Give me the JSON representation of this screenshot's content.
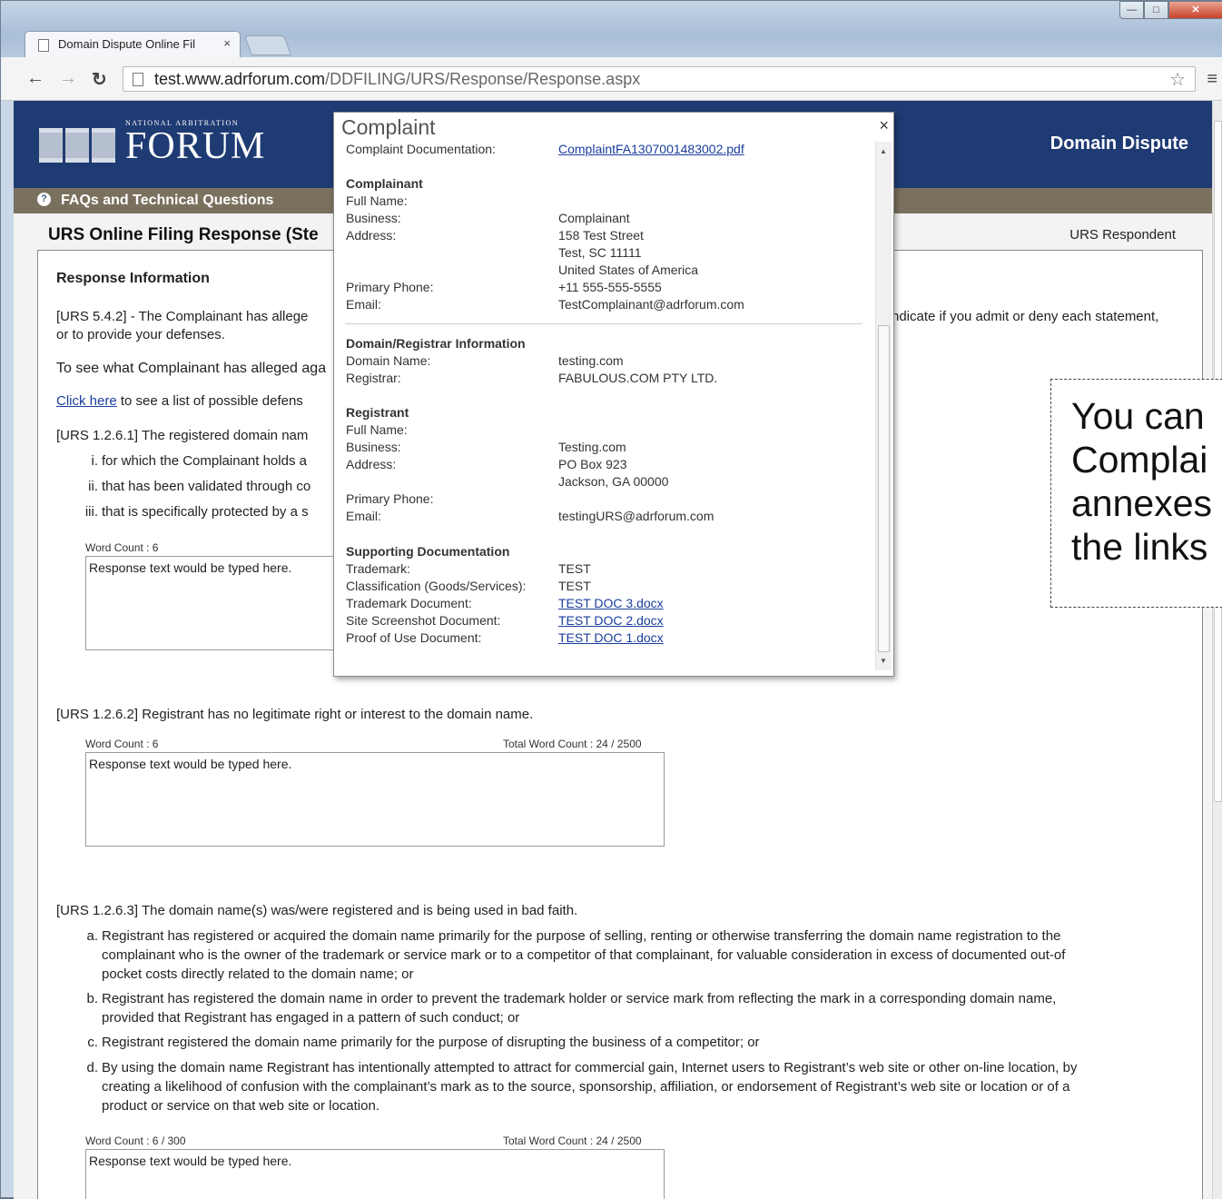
{
  "browser": {
    "tab_title": "Domain Dispute Online Fil",
    "tab_close": "×",
    "url_host": "test.www.adrforum.com",
    "url_path": "/DDFILING/URS/Response/Response.aspx",
    "window_controls": {
      "minimize": "—",
      "maximize": "□",
      "close": "✕"
    }
  },
  "header": {
    "logo_small": "NATIONAL ARBITRATION",
    "logo_big": "FORUM",
    "title": "Domain Dispute",
    "faq_icon": "?",
    "faq_label": "FAQs and Technical Questions"
  },
  "page": {
    "title": "URS Online Filing Response (Ste",
    "role": "URS Respondent"
  },
  "content": {
    "section_heading": "Response Information",
    "intro_1a": "[URS 5.4.2] - The Complainant has allege",
    "intro_1b": "ndicate if you admit or deny each statement,",
    "intro_2": "or to provide your defenses.",
    "see_alleged": "To see what Complainant has alleged aga",
    "click_here": "Click here",
    "click_rest": " to see a list of possible defens",
    "q1": {
      "prompt": "[URS 1.2.6.1] The registered domain nam",
      "items": [
        {
          "marker": "i.",
          "text": "for which the Complainant holds a"
        },
        {
          "marker": "ii.",
          "text": "that has been validated through co"
        },
        {
          "marker": "iii.",
          "text": "that is specifically protected by a s"
        }
      ],
      "word_count": "Word Count : 6",
      "response": "Response text would be typed here."
    },
    "q2": {
      "prompt": "[URS 1.2.6.2] Registrant has no legitimate right or interest to the domain name.",
      "word_count": "Word Count : 6",
      "total_word_count": "Total Word Count : 24 / 2500",
      "response": "Response text would be typed here."
    },
    "q3": {
      "prompt": "[URS 1.2.6.3] The domain name(s) was/were registered and is being used in bad faith.",
      "items": [
        {
          "marker": "a.",
          "lines": [
            "Registrant has registered or acquired the domain name primarily for the purpose of selling, renting or otherwise transferring the domain name registration to the",
            "complainant who is the owner of the trademark or service mark or to a competitor of that complainant, for valuable consideration in excess of documented out-of",
            "pocket costs directly related to the domain name; or"
          ]
        },
        {
          "marker": "b.",
          "lines": [
            "Registrant has registered the domain name in order to prevent the trademark holder or service mark from reflecting the mark in a corresponding domain name,",
            "provided that Registrant has engaged in a pattern of such conduct; or"
          ]
        },
        {
          "marker": "c.",
          "lines": [
            "Registrant registered the domain name primarily for the purpose of disrupting the business of a competitor; or"
          ]
        },
        {
          "marker": "d.",
          "lines": [
            "By using the domain name Registrant has intentionally attempted to attract for commercial gain, Internet users to Registrant’s web site or other on-line location, by",
            "creating a likelihood of confusion with the complainant’s mark as to the source, sponsorship, affiliation, or endorsement of Registrant’s web site or location or of a",
            "product or service on that web site or location."
          ]
        }
      ],
      "word_count": "Word Count : 6 / 300",
      "total_word_count": "Total Word Count : 24 / 2500",
      "response": "Response text would be typed here."
    }
  },
  "modal": {
    "title": "Complaint",
    "close": "×",
    "complaint_doc_label": "Complaint Documentation:",
    "complaint_doc_link": "ComplaintFA1307001483002.pdf",
    "complainant": {
      "heading": "Complainant",
      "full_name_label": "Full Name:",
      "business_label": "Business:",
      "business": "Complainant",
      "address_label": "Address:",
      "address_1": "158 Test Street",
      "address_2": "Test, SC 11111",
      "address_3": "United States of America",
      "phone_label": "Primary Phone:",
      "phone": "+11 555-555-5555",
      "email_label": "Email:",
      "email": "TestComplainant@adrforum.com"
    },
    "domain": {
      "heading": "Domain/Registrar Information",
      "domain_label": "Domain Name:",
      "domain": "testing.com",
      "registrar_label": "Registrar:",
      "registrar": "FABULOUS.COM PTY LTD."
    },
    "registrant": {
      "heading": "Registrant",
      "full_name_label": "Full Name:",
      "business_label": "Business:",
      "business": "Testing.com",
      "address_label": "Address:",
      "address_1": "PO Box 923",
      "address_2": "Jackson, GA 00000",
      "phone_label": "Primary Phone:",
      "email_label": "Email:",
      "email": "testingURS@adrforum.com"
    },
    "supporting": {
      "heading": "Supporting Documentation",
      "trademark_label": "Trademark:",
      "trademark": "TEST",
      "classification_label": "Classification (Goods/Services):",
      "classification": "TEST",
      "tm_doc_label": "Trademark Document:",
      "tm_doc": "TEST DOC 3.docx",
      "screenshot_label": "Site Screenshot Document:",
      "screenshot_doc": "TEST DOC 2.docx",
      "proof_label": "Proof of Use Document:",
      "proof_doc": "TEST DOC 1.docx"
    }
  },
  "callout": {
    "lines": [
      "You can",
      "Complai",
      "annexes",
      "the links"
    ]
  }
}
